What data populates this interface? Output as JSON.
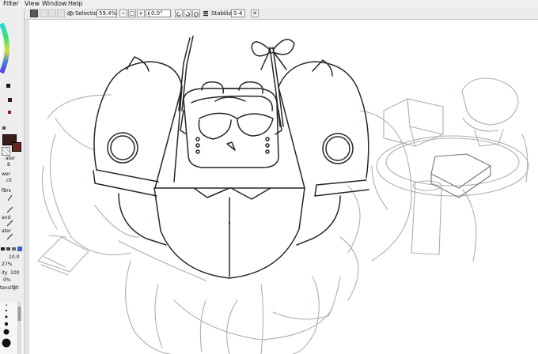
{
  "menu": {
    "filter": "Filter",
    "view": "View",
    "window": "Window",
    "help": "Help"
  },
  "toolbar": {
    "selection_label": "Selection",
    "zoom": "59.4%",
    "zoom_minus": "−",
    "zoom_reset": "□",
    "zoom_plus": "+",
    "zoom_fit": "▪",
    "rotation": "0.0°",
    "stabilizer_label": "Stabilizer",
    "stabilizer_value": "S-4",
    "close_symbol": "✕"
  },
  "panel": {
    "brush_labels": [
      "ater",
      "8",
      "wer",
      "cil",
      "fBrs",
      "",
      "and",
      "ater"
    ],
    "size_value": "10.0",
    "opacity": "27%",
    "density_label": "ity",
    "density_value": "100",
    "blend_percent": "0%",
    "intensity_label": "tensity",
    "intensity_value": "70",
    "brush_sizes": [
      "1",
      "4",
      "6",
      "8",
      "10",
      "20"
    ]
  },
  "colors": {
    "accent_blue": "#3060c8",
    "main_color": "#3a1e1a",
    "sketch_gray": "#b4adab",
    "lineart": "#2b2424"
  }
}
